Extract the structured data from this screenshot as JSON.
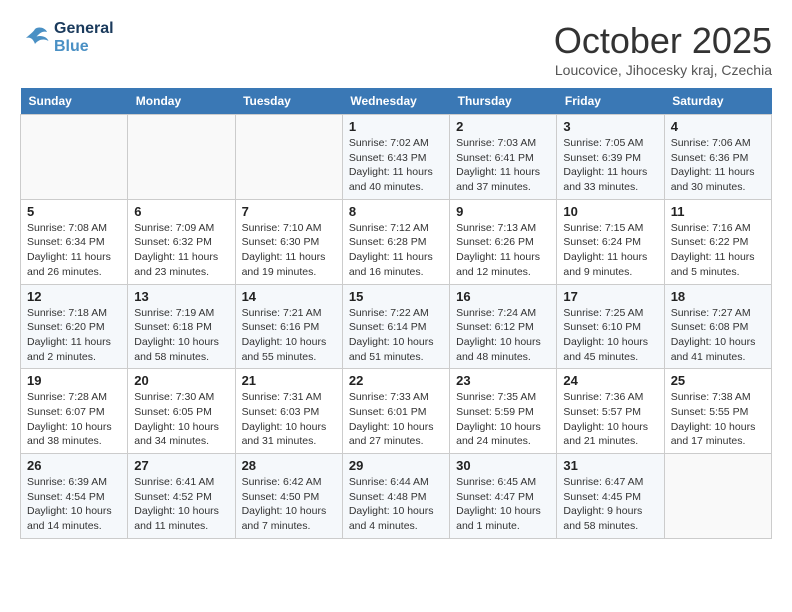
{
  "header": {
    "logo_line1": "General",
    "logo_line2": "Blue",
    "month_title": "October 2025",
    "location": "Loucovice, Jihocesky kraj, Czechia"
  },
  "days_of_week": [
    "Sunday",
    "Monday",
    "Tuesday",
    "Wednesday",
    "Thursday",
    "Friday",
    "Saturday"
  ],
  "weeks": [
    [
      {
        "day": "",
        "info": ""
      },
      {
        "day": "",
        "info": ""
      },
      {
        "day": "",
        "info": ""
      },
      {
        "day": "1",
        "info": "Sunrise: 7:02 AM\nSunset: 6:43 PM\nDaylight: 11 hours and 40 minutes."
      },
      {
        "day": "2",
        "info": "Sunrise: 7:03 AM\nSunset: 6:41 PM\nDaylight: 11 hours and 37 minutes."
      },
      {
        "day": "3",
        "info": "Sunrise: 7:05 AM\nSunset: 6:39 PM\nDaylight: 11 hours and 33 minutes."
      },
      {
        "day": "4",
        "info": "Sunrise: 7:06 AM\nSunset: 6:36 PM\nDaylight: 11 hours and 30 minutes."
      }
    ],
    [
      {
        "day": "5",
        "info": "Sunrise: 7:08 AM\nSunset: 6:34 PM\nDaylight: 11 hours and 26 minutes."
      },
      {
        "day": "6",
        "info": "Sunrise: 7:09 AM\nSunset: 6:32 PM\nDaylight: 11 hours and 23 minutes."
      },
      {
        "day": "7",
        "info": "Sunrise: 7:10 AM\nSunset: 6:30 PM\nDaylight: 11 hours and 19 minutes."
      },
      {
        "day": "8",
        "info": "Sunrise: 7:12 AM\nSunset: 6:28 PM\nDaylight: 11 hours and 16 minutes."
      },
      {
        "day": "9",
        "info": "Sunrise: 7:13 AM\nSunset: 6:26 PM\nDaylight: 11 hours and 12 minutes."
      },
      {
        "day": "10",
        "info": "Sunrise: 7:15 AM\nSunset: 6:24 PM\nDaylight: 11 hours and 9 minutes."
      },
      {
        "day": "11",
        "info": "Sunrise: 7:16 AM\nSunset: 6:22 PM\nDaylight: 11 hours and 5 minutes."
      }
    ],
    [
      {
        "day": "12",
        "info": "Sunrise: 7:18 AM\nSunset: 6:20 PM\nDaylight: 11 hours and 2 minutes."
      },
      {
        "day": "13",
        "info": "Sunrise: 7:19 AM\nSunset: 6:18 PM\nDaylight: 10 hours and 58 minutes."
      },
      {
        "day": "14",
        "info": "Sunrise: 7:21 AM\nSunset: 6:16 PM\nDaylight: 10 hours and 55 minutes."
      },
      {
        "day": "15",
        "info": "Sunrise: 7:22 AM\nSunset: 6:14 PM\nDaylight: 10 hours and 51 minutes."
      },
      {
        "day": "16",
        "info": "Sunrise: 7:24 AM\nSunset: 6:12 PM\nDaylight: 10 hours and 48 minutes."
      },
      {
        "day": "17",
        "info": "Sunrise: 7:25 AM\nSunset: 6:10 PM\nDaylight: 10 hours and 45 minutes."
      },
      {
        "day": "18",
        "info": "Sunrise: 7:27 AM\nSunset: 6:08 PM\nDaylight: 10 hours and 41 minutes."
      }
    ],
    [
      {
        "day": "19",
        "info": "Sunrise: 7:28 AM\nSunset: 6:07 PM\nDaylight: 10 hours and 38 minutes."
      },
      {
        "day": "20",
        "info": "Sunrise: 7:30 AM\nSunset: 6:05 PM\nDaylight: 10 hours and 34 minutes."
      },
      {
        "day": "21",
        "info": "Sunrise: 7:31 AM\nSunset: 6:03 PM\nDaylight: 10 hours and 31 minutes."
      },
      {
        "day": "22",
        "info": "Sunrise: 7:33 AM\nSunset: 6:01 PM\nDaylight: 10 hours and 27 minutes."
      },
      {
        "day": "23",
        "info": "Sunrise: 7:35 AM\nSunset: 5:59 PM\nDaylight: 10 hours and 24 minutes."
      },
      {
        "day": "24",
        "info": "Sunrise: 7:36 AM\nSunset: 5:57 PM\nDaylight: 10 hours and 21 minutes."
      },
      {
        "day": "25",
        "info": "Sunrise: 7:38 AM\nSunset: 5:55 PM\nDaylight: 10 hours and 17 minutes."
      }
    ],
    [
      {
        "day": "26",
        "info": "Sunrise: 6:39 AM\nSunset: 4:54 PM\nDaylight: 10 hours and 14 minutes."
      },
      {
        "day": "27",
        "info": "Sunrise: 6:41 AM\nSunset: 4:52 PM\nDaylight: 10 hours and 11 minutes."
      },
      {
        "day": "28",
        "info": "Sunrise: 6:42 AM\nSunset: 4:50 PM\nDaylight: 10 hours and 7 minutes."
      },
      {
        "day": "29",
        "info": "Sunrise: 6:44 AM\nSunset: 4:48 PM\nDaylight: 10 hours and 4 minutes."
      },
      {
        "day": "30",
        "info": "Sunrise: 6:45 AM\nSunset: 4:47 PM\nDaylight: 10 hours and 1 minute."
      },
      {
        "day": "31",
        "info": "Sunrise: 6:47 AM\nSunset: 4:45 PM\nDaylight: 9 hours and 58 minutes."
      },
      {
        "day": "",
        "info": ""
      }
    ]
  ]
}
